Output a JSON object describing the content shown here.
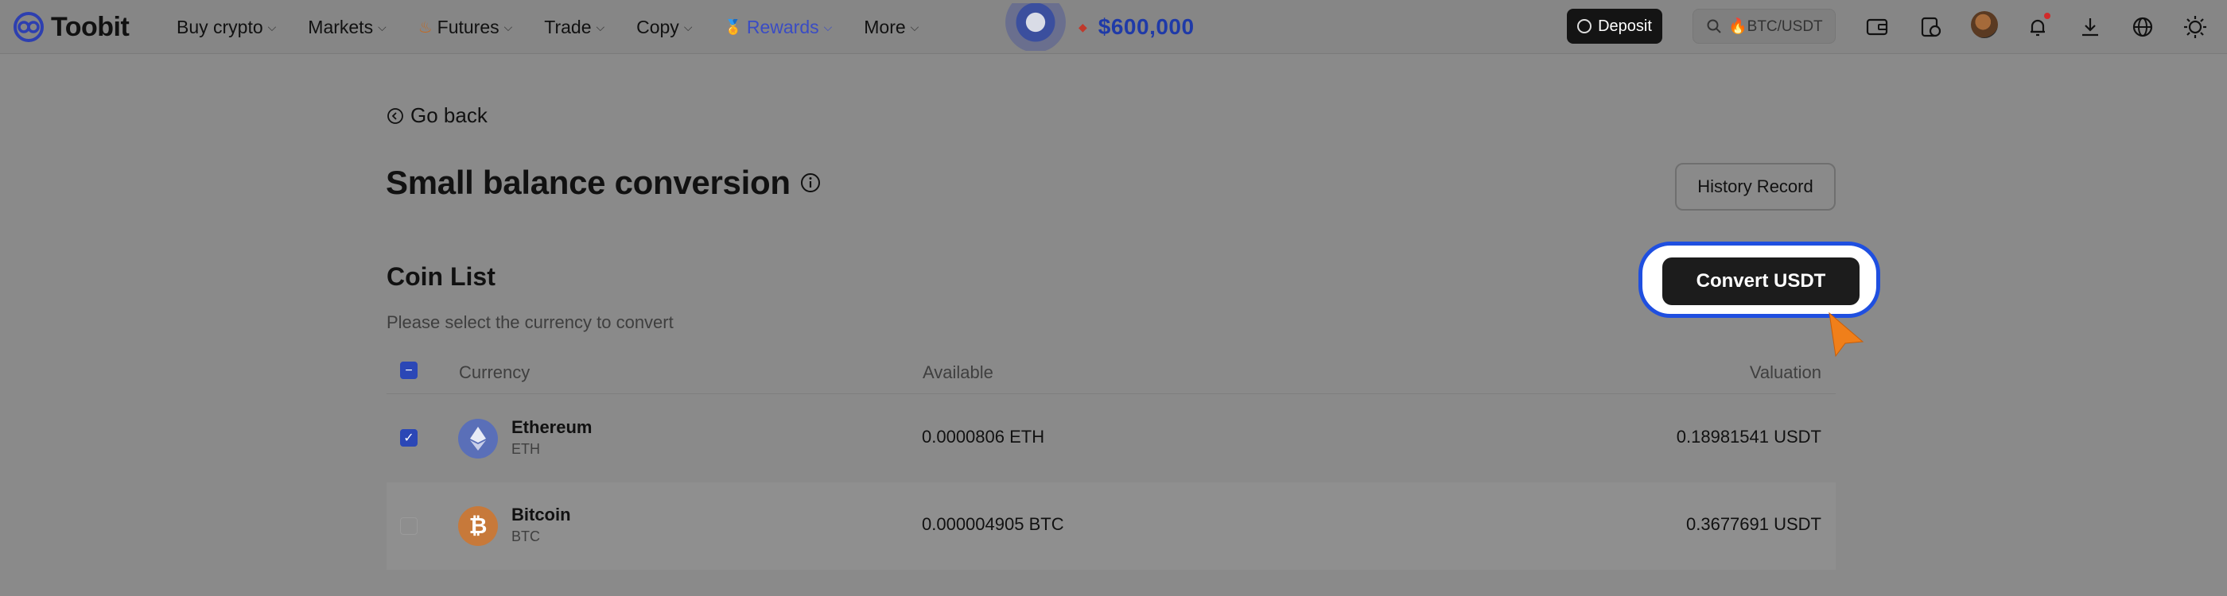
{
  "brand": {
    "name": "Toobit"
  },
  "nav": [
    {
      "label": "Buy crypto",
      "has_chevron": true
    },
    {
      "label": "Markets",
      "has_chevron": true
    },
    {
      "label": "Futures",
      "has_chevron": true,
      "icon": "flame-icon"
    },
    {
      "label": "Trade",
      "has_chevron": true
    },
    {
      "label": "Copy",
      "has_chevron": true
    },
    {
      "label": "Rewards",
      "has_chevron": true,
      "icon": "medal-icon"
    },
    {
      "label": "More",
      "has_chevron": true
    }
  ],
  "promo": {
    "amount": "$600,000"
  },
  "toolbar": {
    "deposit_label": "Deposit",
    "search_placeholder": "🔥BTC/USDT",
    "icons": [
      "wallet-icon",
      "orders-icon",
      "avatar",
      "bell-icon",
      "download-icon",
      "globe-icon",
      "theme-toggle-icon"
    ]
  },
  "page": {
    "go_back": "Go back",
    "title": "Small balance conversion",
    "history_label": "History Record",
    "coin_list_title": "Coin List",
    "subtitle": "Please select the currency to convert",
    "convert_label": "Convert USDT"
  },
  "table": {
    "headers": {
      "currency": "Currency",
      "available": "Available",
      "valuation": "Valuation"
    },
    "rows": [
      {
        "name": "Ethereum",
        "symbol": "ETH",
        "available": "0.0000806 ETH",
        "valuation": "0.18981541 USDT",
        "checked": true,
        "icon_color": "#5a6fb8",
        "icon": "ethereum-icon"
      },
      {
        "name": "Bitcoin",
        "symbol": "BTC",
        "available": "0.000004905 BTC",
        "valuation": "0.3677691 USDT",
        "checked": false,
        "icon_color": "#c7793a",
        "icon": "bitcoin-icon"
      }
    ]
  },
  "colors": {
    "accent": "#2b47b6",
    "highlight": "#1f4fe0",
    "cursor": "#f07f1a",
    "overlay_bg": "#8a8a8a"
  }
}
